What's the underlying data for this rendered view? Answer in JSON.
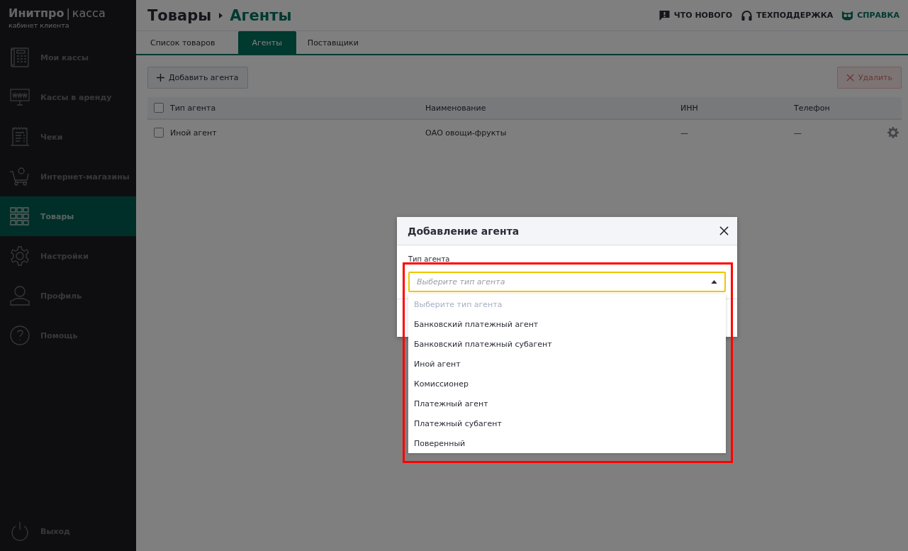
{
  "brand": {
    "name": "Инитпро",
    "separator": "|",
    "product": "касса",
    "subtitle": "кабинет клиента"
  },
  "sidebar": {
    "items": [
      {
        "kind": "register",
        "label": "Мои кассы",
        "selected": false
      },
      {
        "kind": "monitor",
        "label": "Кассы в аренду",
        "selected": false
      },
      {
        "kind": "receipt",
        "label": "Чеки",
        "selected": false
      },
      {
        "kind": "cart",
        "label": "Интернет-магазины",
        "selected": false
      },
      {
        "kind": "grid",
        "label": "Товары",
        "selected": true
      },
      {
        "kind": "gear",
        "label": "Настройки",
        "selected": false
      },
      {
        "kind": "person",
        "label": "Профиль",
        "selected": false
      },
      {
        "kind": "help",
        "label": "Помощь",
        "selected": false
      }
    ],
    "logout": {
      "label": "Выход"
    }
  },
  "header": {
    "breadcrumb": [
      "Товары",
      "Агенты"
    ],
    "links": [
      {
        "kind": "chat",
        "label": "ЧТО НОВОГО",
        "highlighted": false
      },
      {
        "kind": "headset",
        "label": "ТЕХПОДДЕРЖКА",
        "highlighted": false
      },
      {
        "kind": "owl",
        "label": "СПРАВКА",
        "highlighted": true
      }
    ]
  },
  "tabs": [
    {
      "label": "Список товаров",
      "selected": false
    },
    {
      "label": "Агенты",
      "selected": true
    },
    {
      "label": "Поставщики",
      "selected": false
    }
  ],
  "toolbar": {
    "add_button": "Добавить агента",
    "delete_button": {
      "label": "Удалить",
      "disabled": true
    }
  },
  "table": {
    "all_checked": false,
    "columns": [
      "Тип агента",
      "Наименование",
      "ИНН",
      "Телефон"
    ],
    "rows": [
      {
        "checked": false,
        "cells": [
          "Иной агент",
          "ОАО овощи-фрукты",
          "—",
          "—"
        ]
      }
    ]
  },
  "modal": {
    "title": "Добавление агента",
    "field": {
      "label": "Тип агента",
      "placeholder": "Выберите тип агента",
      "expanded": true,
      "options": [
        {
          "label": "Выберите тип агента",
          "disabled": true
        },
        {
          "label": "Банковский платежный агент",
          "disabled": false
        },
        {
          "label": "Банковский платежный субагент",
          "disabled": false
        },
        {
          "label": "Иной агент",
          "disabled": false
        },
        {
          "label": "Комиссионер",
          "disabled": false
        },
        {
          "label": "Платежный агент",
          "disabled": false
        },
        {
          "label": "Платежный субагент",
          "disabled": false
        },
        {
          "label": "Поверенный",
          "disabled": false
        }
      ]
    }
  }
}
